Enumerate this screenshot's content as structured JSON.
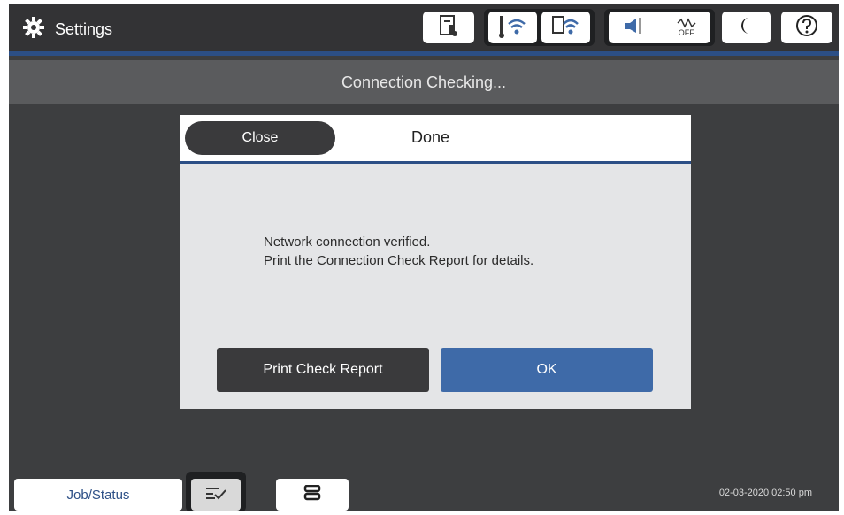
{
  "header": {
    "title": "Settings",
    "title_icon": "gear-icon",
    "status_icons": [
      "ink-supply-icon",
      "wifi-icon",
      "wifi-direct-icon",
      "sound-icon",
      "quiet-mode-off-icon",
      "sleep-moon-icon",
      "help-icon"
    ],
    "quiet_mode_label": "OFF"
  },
  "subheader": {
    "text": "Connection Checking..."
  },
  "dialog": {
    "close_label": "Close",
    "title": "Done",
    "message_line1": "Network connection verified.",
    "message_line2": "Print the Connection Check Report for details.",
    "print_button_label": "Print Check Report",
    "ok_button_label": "OK"
  },
  "bottom": {
    "job_status_label": "Job/Status",
    "datetime": "02-03-2020 02:50 pm"
  },
  "colors": {
    "accent": "#2c4f86",
    "ok_button": "#3e6aa8",
    "dark_button": "#3a3a3c",
    "background": "#3d3e40"
  }
}
